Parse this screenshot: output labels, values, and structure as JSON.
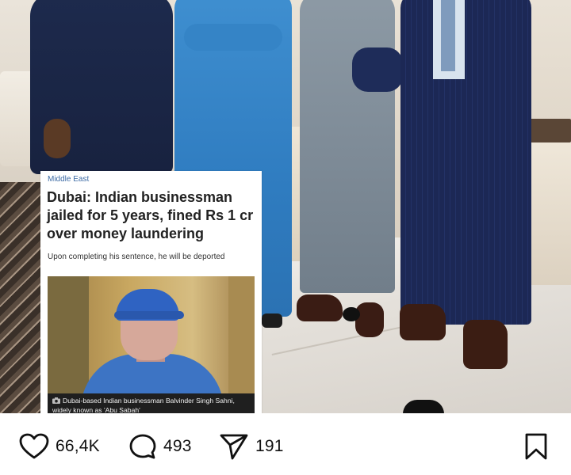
{
  "news_card": {
    "section": "Middle East",
    "headline": "Dubai: Indian businessman jailed for 5 years, fined Rs 1 cr over money laundering",
    "subheadline": "Upon completing his sentence, he will be deported",
    "caption": "Dubai-based Indian businessman Balvinder Singh Sahni, widely known as 'Abu Sabah'",
    "caption_icon": "camera-icon"
  },
  "actions": {
    "likes": "66,4K",
    "comments": "493",
    "shares": "191",
    "like_icon": "heart-icon",
    "comment_icon": "comment-bubble-icon",
    "share_icon": "paper-plane-icon",
    "save_icon": "bookmark-icon"
  }
}
